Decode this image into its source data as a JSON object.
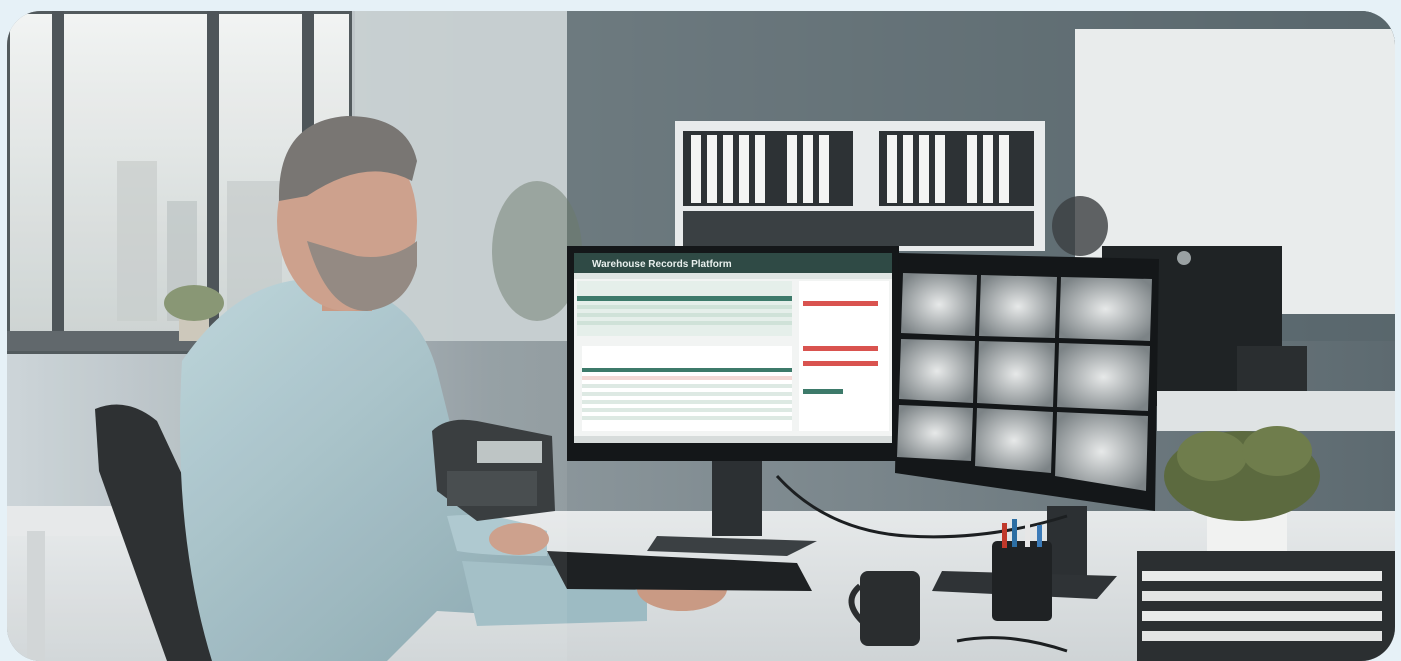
{
  "scene": {
    "description_tag": "office-photo",
    "accent": "#3d7a6a",
    "warning": "#d9534f"
  },
  "left_monitor": {
    "app_title": "Warehouse Records Platform"
  }
}
